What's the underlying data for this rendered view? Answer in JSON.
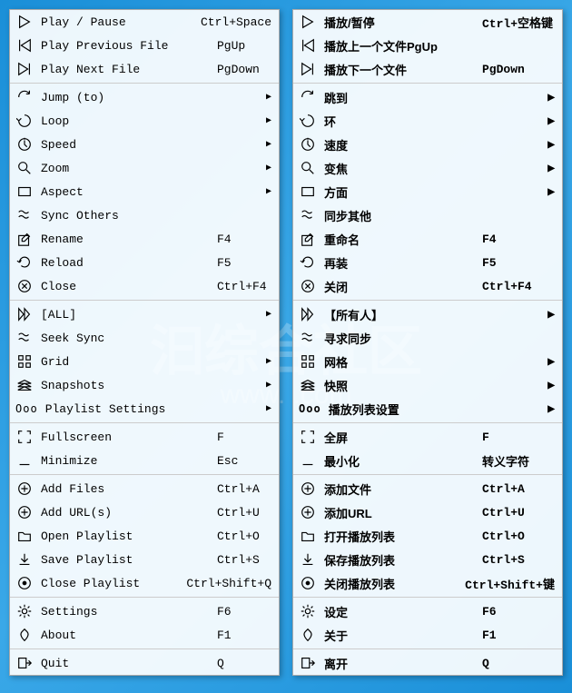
{
  "watermark": "汩综合社区",
  "watermark_url": "www. .com",
  "menu_left": {
    "groups": [
      [
        {
          "icon": "play-icon",
          "name": "play-pause",
          "label": "Play / Pause",
          "shortcut": "Ctrl+Space"
        },
        {
          "icon": "prev-icon",
          "name": "play-prev",
          "label": "Play Previous File",
          "shortcut": "PgUp"
        },
        {
          "icon": "next-icon",
          "name": "play-next",
          "label": "Play Next File",
          "shortcut": "PgDown"
        }
      ],
      [
        {
          "icon": "jump-icon",
          "name": "jump-to",
          "label": "Jump (to)",
          "submenu": true
        },
        {
          "icon": "loop-icon",
          "name": "loop",
          "label": "Loop",
          "submenu": true
        },
        {
          "icon": "speed-icon",
          "name": "speed",
          "label": "Speed",
          "submenu": true
        },
        {
          "icon": "zoom-icon",
          "name": "zoom",
          "label": "Zoom",
          "submenu": true
        },
        {
          "icon": "aspect-icon",
          "name": "aspect",
          "label": "Aspect",
          "submenu": true
        },
        {
          "icon": "sync-icon",
          "name": "sync-others",
          "label": "Sync Others"
        },
        {
          "icon": "rename-icon",
          "name": "rename",
          "label": "Rename",
          "shortcut": "F4"
        },
        {
          "icon": "reload-icon",
          "name": "reload",
          "label": "Reload",
          "shortcut": "F5"
        },
        {
          "icon": "close-icon",
          "name": "close",
          "label": "Close",
          "shortcut": "Ctrl+F4"
        }
      ],
      [
        {
          "icon": "all-icon",
          "name": "all",
          "label": "[ALL]",
          "submenu": true
        },
        {
          "icon": "sync-icon",
          "name": "seek-sync",
          "label": "Seek Sync"
        },
        {
          "icon": "grid-icon",
          "name": "grid",
          "label": "Grid",
          "submenu": true
        },
        {
          "icon": "snapshots-icon",
          "name": "snapshots",
          "label": "Snapshots",
          "submenu": true
        },
        {
          "icon": "ooo-icon",
          "name": "playlist-settings",
          "label": "Playlist Settings",
          "submenu": true
        }
      ],
      [
        {
          "icon": "fullscreen-icon",
          "name": "fullscreen",
          "label": "Fullscreen",
          "shortcut": "F"
        },
        {
          "icon": "minimize-icon",
          "name": "minimize",
          "label": "Minimize",
          "shortcut": "Esc"
        }
      ],
      [
        {
          "icon": "add-icon",
          "name": "add-files",
          "label": "Add Files",
          "shortcut": "Ctrl+A"
        },
        {
          "icon": "add-icon",
          "name": "add-urls",
          "label": "Add URL(s)",
          "shortcut": "Ctrl+U"
        },
        {
          "icon": "folder-icon",
          "name": "open-playlist",
          "label": "Open Playlist",
          "shortcut": "Ctrl+O"
        },
        {
          "icon": "save-icon",
          "name": "save-playlist",
          "label": "Save Playlist",
          "shortcut": "Ctrl+S"
        },
        {
          "icon": "close-pl-icon",
          "name": "close-playlist",
          "label": "Close Playlist",
          "shortcut": "Ctrl+Shift+Q"
        }
      ],
      [
        {
          "icon": "gear-icon",
          "name": "settings",
          "label": "Settings",
          "shortcut": "F6"
        },
        {
          "icon": "about-icon",
          "name": "about",
          "label": "About",
          "shortcut": "F1"
        }
      ],
      [
        {
          "icon": "quit-icon",
          "name": "quit",
          "label": "Quit",
          "shortcut": "Q"
        }
      ]
    ]
  },
  "menu_right": {
    "groups": [
      [
        {
          "icon": "play-icon",
          "name": "play-pause-cn",
          "label": "播放/暂停",
          "shortcut": "Ctrl+空格键"
        },
        {
          "icon": "prev-icon",
          "name": "play-prev-cn",
          "label": "播放上一个文件PgUp"
        },
        {
          "icon": "next-icon",
          "name": "play-next-cn",
          "label": "播放下一个文件",
          "shortcut": "PgDown"
        }
      ],
      [
        {
          "icon": "jump-icon",
          "name": "jump-to-cn",
          "label": "跳到",
          "submenu": true
        },
        {
          "icon": "loop-icon",
          "name": "loop-cn",
          "label": "环",
          "submenu": true
        },
        {
          "icon": "speed-icon",
          "name": "speed-cn",
          "label": "速度",
          "submenu": true
        },
        {
          "icon": "zoom-icon",
          "name": "zoom-cn",
          "label": "变焦",
          "submenu": true
        },
        {
          "icon": "aspect-icon",
          "name": "aspect-cn",
          "label": "方面",
          "submenu": true
        },
        {
          "icon": "sync-icon",
          "name": "sync-others-cn",
          "label": "同步其他"
        },
        {
          "icon": "rename-icon",
          "name": "rename-cn",
          "label": "重命名",
          "shortcut": "F4"
        },
        {
          "icon": "reload-icon",
          "name": "reload-cn",
          "label": "再装",
          "shortcut": "F5"
        },
        {
          "icon": "close-icon",
          "name": "close-cn",
          "label": "关闭",
          "shortcut": "Ctrl+F4"
        }
      ],
      [
        {
          "icon": "all-icon",
          "name": "all-cn",
          "label": "【所有人】",
          "submenu": true
        },
        {
          "icon": "sync-icon",
          "name": "seek-sync-cn",
          "label": "寻求同步"
        },
        {
          "icon": "grid-icon",
          "name": "grid-cn",
          "label": "网格",
          "submenu": true
        },
        {
          "icon": "snapshots-icon",
          "name": "snapshots-cn",
          "label": "快照",
          "submenu": true
        },
        {
          "icon": "ooo-icon",
          "name": "playlist-settings-cn",
          "label": "播放列表设置",
          "submenu": true
        }
      ],
      [
        {
          "icon": "fullscreen-icon",
          "name": "fullscreen-cn",
          "label": "全屏",
          "shortcut": "F"
        },
        {
          "icon": "minimize-icon",
          "name": "minimize-cn",
          "label": "最小化",
          "shortcut": "转义字符"
        }
      ],
      [
        {
          "icon": "add-icon",
          "name": "add-files-cn",
          "label": "添加文件",
          "shortcut": "Ctrl+A"
        },
        {
          "icon": "add-icon",
          "name": "add-urls-cn",
          "label": "添加URL",
          "shortcut": "Ctrl+U"
        },
        {
          "icon": "folder-icon",
          "name": "open-playlist-cn",
          "label": "打开播放列表",
          "shortcut": "Ctrl+O"
        },
        {
          "icon": "save-icon",
          "name": "save-playlist-cn",
          "label": "保存播放列表",
          "shortcut": "Ctrl+S"
        },
        {
          "icon": "close-pl-icon",
          "name": "close-playlist-cn",
          "label": "关闭播放列表",
          "shortcut": "Ctrl+Shift+键"
        }
      ],
      [
        {
          "icon": "gear-icon",
          "name": "settings-cn",
          "label": "设定",
          "shortcut": "F6"
        },
        {
          "icon": "about-icon",
          "name": "about-cn",
          "label": "关于",
          "shortcut": "F1"
        }
      ],
      [
        {
          "icon": "quit-icon",
          "name": "quit-cn",
          "label": "离开",
          "shortcut": "Q"
        }
      ]
    ]
  }
}
